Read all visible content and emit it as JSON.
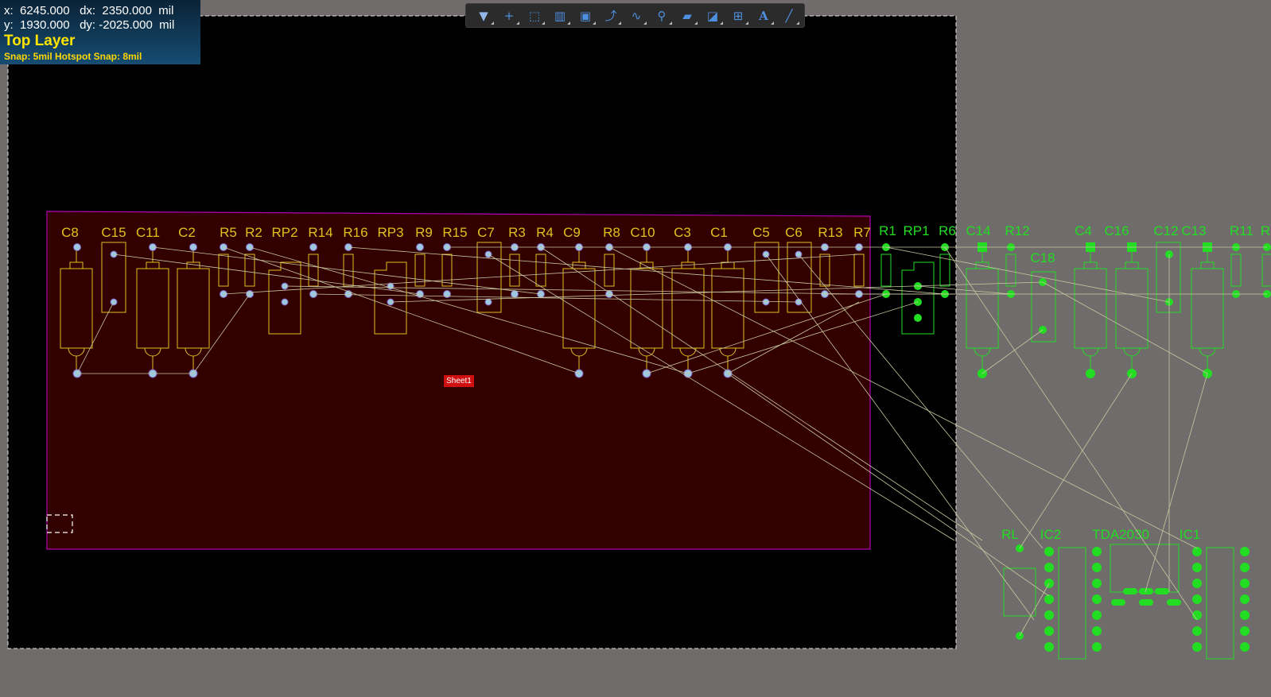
{
  "status_hud": {
    "x_line": "x:  6245.000   dx:  2350.000  mil",
    "y_line": "y:  1930.000   dy: -2025.000  mil",
    "layer": "Top Layer",
    "snap": "Snap: 5mil Hotspot Snap: 8mil"
  },
  "toolbar": [
    {
      "name": "filter-tool",
      "glyph": "▼",
      "interactable": true
    },
    {
      "name": "add-tool",
      "glyph": "+",
      "interactable": true
    },
    {
      "name": "select-rect-tool",
      "glyph": "⬚",
      "interactable": true
    },
    {
      "name": "align-tool",
      "glyph": "▥",
      "interactable": true
    },
    {
      "name": "component-tool",
      "glyph": "▣",
      "interactable": true
    },
    {
      "name": "route-tool",
      "glyph": "⤴",
      "interactable": true
    },
    {
      "name": "interactive-route-tool",
      "glyph": "∿",
      "interactable": true
    },
    {
      "name": "via-tool",
      "glyph": "⚲",
      "interactable": true
    },
    {
      "name": "polygon-tool",
      "glyph": "▰",
      "interactable": true
    },
    {
      "name": "region-tool",
      "glyph": "◪",
      "interactable": true
    },
    {
      "name": "dimension-tool",
      "glyph": "⊞",
      "interactable": true
    },
    {
      "name": "text-tool",
      "glyph": "A",
      "interactable": true
    },
    {
      "name": "line-tool",
      "glyph": "╱",
      "interactable": true
    }
  ],
  "sheet_label": "Sheet1",
  "colors": {
    "workspace": "#6f6c6b",
    "board": "#000000",
    "room_fill": "#330000",
    "room_border": "#b000b0",
    "placed_component": "#e0c020",
    "unplaced_component": "#22dd22",
    "ratsnest": "#c8c8a0",
    "pad": "#9cc8e0"
  },
  "placed_components": [
    "C8",
    "C15",
    "C11",
    "C2",
    "R5",
    "R2",
    "RP2",
    "R14",
    "R16",
    "RP3",
    "R9",
    "R15",
    "C7",
    "R3",
    "R4",
    "C9",
    "R8",
    "C10",
    "C3",
    "C1",
    "C5",
    "C6",
    "R13",
    "R7"
  ],
  "unplaced_components": [
    "R1",
    "RP1",
    "R6",
    "C14",
    "R12",
    "C18",
    "C4",
    "C16",
    "C12",
    "C13",
    "R11",
    "R",
    "RL",
    "IC2",
    "TDA2030",
    "IC1"
  ]
}
